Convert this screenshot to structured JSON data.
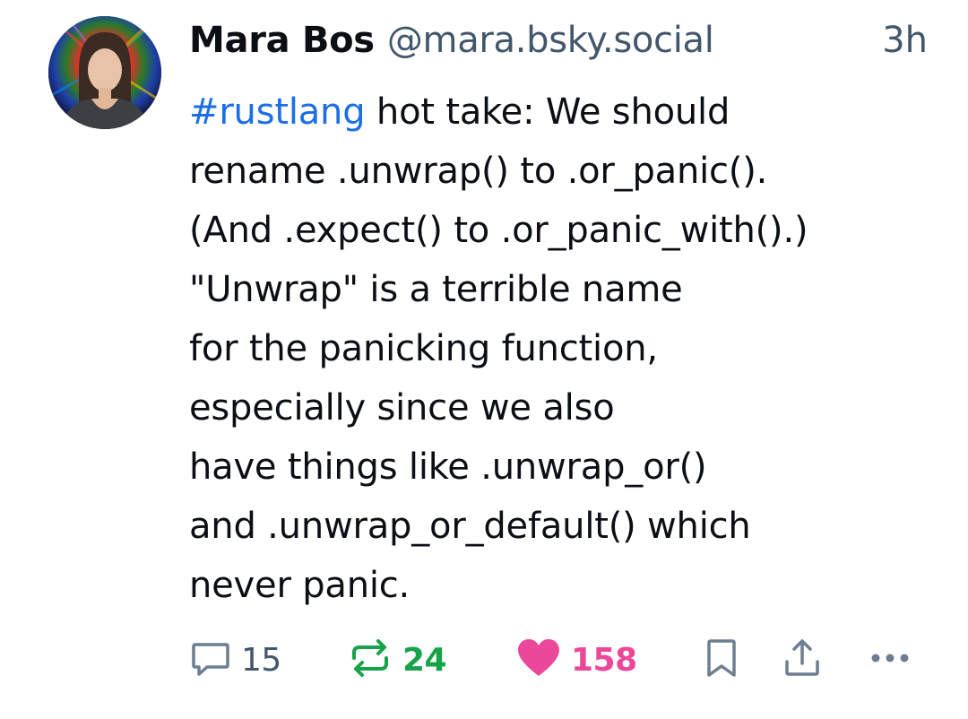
{
  "post": {
    "author_name": "Mara Bos",
    "author_handle": "@mara.bsky.social",
    "timestamp": "3h",
    "hashtag": "#rustlang",
    "lines": [
      " hot take: We should",
      "rename .unwrap() to .or_panic().",
      "(And .expect() to .or_panic_with().)",
      "\"Unwrap\" is a terrible name",
      "for the panicking function,",
      "especially since we also",
      "have things like .unwrap_or()",
      "and .unwrap_or_default() which",
      "never panic."
    ]
  },
  "actions": {
    "reply_icon": "speech-bubble-icon",
    "reply_count": "15",
    "repost_icon": "repost-arrows-icon",
    "repost_count": "24",
    "like_icon": "heart-icon",
    "like_count": "158",
    "bookmark_icon": "bookmark-icon",
    "share_icon": "share-icon",
    "more_icon": "ellipsis-icon"
  },
  "colors": {
    "hashtag": "#1d6ee6",
    "handle": "#42576c",
    "repost": "#17a34a",
    "like": "#ec4899"
  }
}
